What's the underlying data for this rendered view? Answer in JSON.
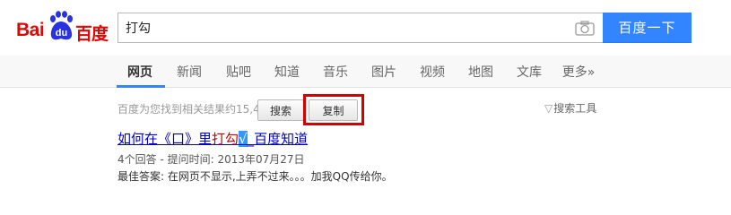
{
  "logo": {
    "left": "Bai",
    "badge": "du",
    "right": "百度"
  },
  "search": {
    "value": "打勾",
    "button_label": "百度一下"
  },
  "tabs": [
    {
      "label": "网页",
      "active": true
    },
    {
      "label": "新闻"
    },
    {
      "label": "贴吧"
    },
    {
      "label": "知道"
    },
    {
      "label": "音乐"
    },
    {
      "label": "图片"
    },
    {
      "label": "视频"
    },
    {
      "label": "地图"
    },
    {
      "label": "文库"
    },
    {
      "label": "更多»"
    }
  ],
  "results": {
    "count_text": "百度为您找到相关结果约15,4",
    "search_tools": "搜索工具",
    "items": [
      {
        "title_prefix": "如何在《口》里",
        "title_em": "打勾",
        "title_sel": "√",
        "title_suffix": "_百度知道",
        "meta": "4个回答 - 提问时间: 2013年07月27日",
        "abstract": "最佳答案: 在网页不显示,上弄不过来。。。加我QQ传给你。"
      }
    ]
  },
  "context_menu": {
    "search_label": "搜索",
    "copy_label": "复制"
  },
  "colors": {
    "brand_red": "#e10602",
    "brand_blue": "#3385ff",
    "link": "#0000cc",
    "highlight": "#d40000"
  }
}
